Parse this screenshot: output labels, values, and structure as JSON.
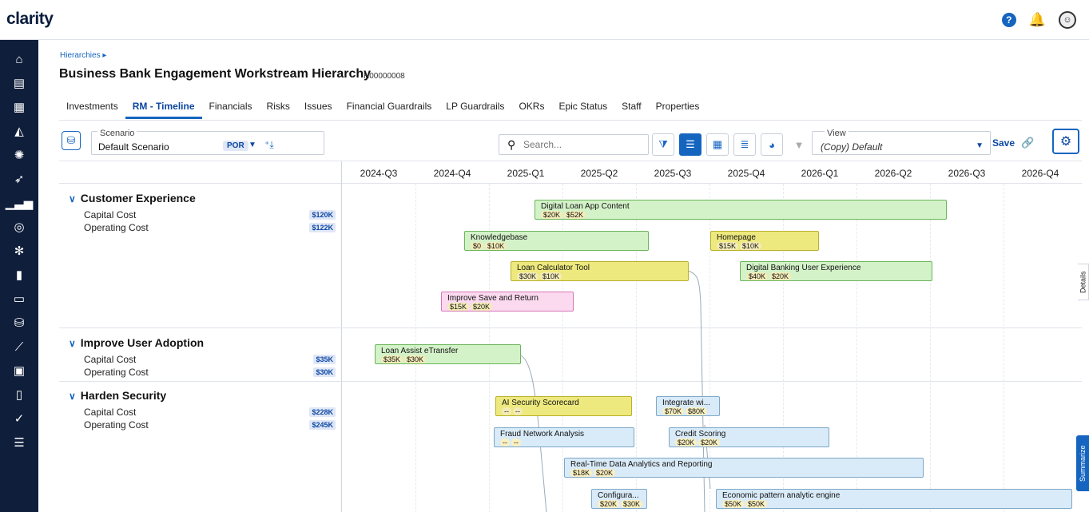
{
  "app": {
    "logo": "clarity"
  },
  "breadcrumb": "Hierarchies ▸",
  "title": "Business Bank Engagement Workstream Hierarchy",
  "id": "H00000008",
  "tabs": [
    "Investments",
    "RM - Timeline",
    "Financials",
    "Risks",
    "Issues",
    "Financial Guardrails",
    "LP Guardrails",
    "OKRs",
    "Epic Status",
    "Staff",
    "Properties"
  ],
  "active_tab": "RM - Timeline",
  "toolbar": {
    "scenario_label": "Scenario",
    "scenario_value": "Default Scenario",
    "scenario_badge": "POR",
    "search_placeholder": "Search...",
    "view_label": "View",
    "view_value": "(Copy) Default",
    "save_label": "Save"
  },
  "quarters": [
    "2024-Q3",
    "2024-Q4",
    "2025-Q1",
    "2025-Q2",
    "2025-Q3",
    "2025-Q4",
    "2026-Q1",
    "2026-Q2",
    "2026-Q3",
    "2026-Q4"
  ],
  "groups": [
    {
      "name": "Customer Experience",
      "capital_label": "Capital Cost",
      "capital": "$120K",
      "operating_label": "Operating Cost",
      "operating": "$122K"
    },
    {
      "name": "Improve User Adoption",
      "capital_label": "Capital Cost",
      "capital": "$35K",
      "operating_label": "Operating Cost",
      "operating": "$30K"
    },
    {
      "name": "Harden Security",
      "capital_label": "Capital Cost",
      "capital": "$228K",
      "operating_label": "Operating Cost",
      "operating": "$245K"
    }
  ],
  "bars": [
    {
      "name": "Digital Loan App Content",
      "costs": [
        "$20K",
        "$52K"
      ],
      "color": "green"
    },
    {
      "name": "Knowledgebase",
      "costs": [
        "$0",
        "$10K"
      ],
      "color": "green"
    },
    {
      "name": "Homepage",
      "costs": [
        "$15K",
        "$10K"
      ],
      "color": "yellow"
    },
    {
      "name": "Loan Calculator Tool",
      "costs": [
        "$30K",
        "$10K"
      ],
      "color": "yellow"
    },
    {
      "name": "Digital Banking User Experience",
      "costs": [
        "$40K",
        "$20K"
      ],
      "color": "green"
    },
    {
      "name": "Improve Save and Return",
      "costs": [
        "$15K",
        "$20K"
      ],
      "color": "pink"
    },
    {
      "name": "Loan Assist eTransfer",
      "costs": [
        "$35K",
        "$30K"
      ],
      "color": "green"
    },
    {
      "name": "AI Security Scorecard",
      "costs": [
        "--",
        "--"
      ],
      "color": "yellow"
    },
    {
      "name": "Integrate wi...",
      "costs": [
        "$70K",
        "$80K"
      ],
      "color": "blue"
    },
    {
      "name": "Fraud Network Analysis",
      "costs": [
        "--",
        "--"
      ],
      "color": "blue"
    },
    {
      "name": "Credit Scoring",
      "costs": [
        "$20K",
        "$20K"
      ],
      "color": "blue"
    },
    {
      "name": "Real-Time Data Analytics and Reporting",
      "costs": [
        "$18K",
        "$20K"
      ],
      "color": "blue"
    },
    {
      "name": "Configura...",
      "costs": [
        "$20K",
        "$30K"
      ],
      "color": "blue"
    },
    {
      "name": "Economic pattern analytic engine",
      "costs": [
        "$50K",
        "$50K"
      ],
      "color": "blue"
    }
  ],
  "side": {
    "details": "Details",
    "summarize": "Summarize"
  },
  "colors": {
    "accent": "#1565c0",
    "nav": "#0f1e3b",
    "green": "#d3f2c8",
    "yellow": "#eee97e",
    "pink": "#fbd9ef",
    "blue": "#d9ebf8"
  },
  "nav_icons": [
    "home-icon",
    "dashboard-icon",
    "grid-icon",
    "chart-area-icon",
    "idea-icon",
    "rocket-icon",
    "bar-chart-icon",
    "target-icon",
    "hub-icon",
    "document-icon",
    "presentation-icon",
    "database-icon",
    "trend-icon",
    "report-icon",
    "clipboard-icon",
    "check-icon",
    "list-icon"
  ]
}
